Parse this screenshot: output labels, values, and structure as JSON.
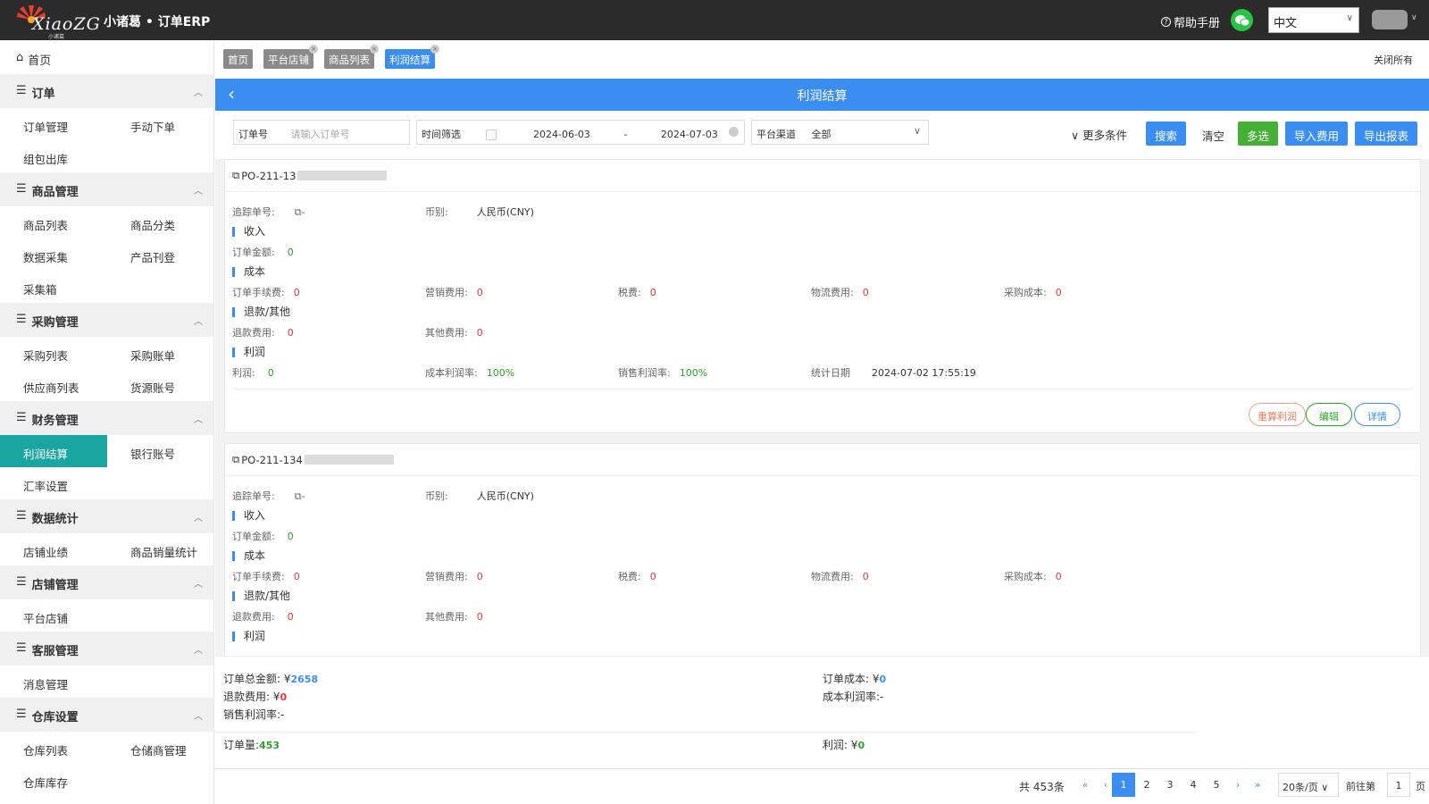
{
  "app": {
    "logo_text": "XiaoZG",
    "logo_sub": "小诸葛",
    "title": "小诸葛 • 订单ERP",
    "help": "帮助手册",
    "language": "中文"
  },
  "sidebar": {
    "home": "首页",
    "groups": [
      {
        "label": "订单",
        "items": [
          "订单管理",
          "手动下单",
          "组包出库"
        ]
      },
      {
        "label": "商品管理",
        "items": [
          "商品列表",
          "商品分类",
          "数据采集",
          "产品刊登",
          "采集箱"
        ]
      },
      {
        "label": "采购管理",
        "items": [
          "采购列表",
          "采购账单",
          "供应商列表",
          "货源账号"
        ]
      },
      {
        "label": "财务管理",
        "items": [
          "利润结算",
          "银行账号",
          "汇率设置"
        ],
        "active": "利润结算"
      },
      {
        "label": "数据统计",
        "items": [
          "店铺业绩",
          "商品销量统计"
        ]
      },
      {
        "label": "店铺管理",
        "items": [
          "平台店铺"
        ]
      },
      {
        "label": "客服管理",
        "items": [
          "消息管理"
        ]
      },
      {
        "label": "仓库设置",
        "items": [
          "仓库列表",
          "仓储商管理",
          "仓库库存"
        ]
      }
    ]
  },
  "tabs": [
    "首页",
    "平台店铺",
    "商品列表",
    "利润结算"
  ],
  "close_all": "关闭所有",
  "page_title": "利润结算",
  "filters": {
    "order_label": "订单号",
    "order_placeholder": "请输入订单号",
    "time_label": "时间筛选",
    "date_start": "2024-06-03",
    "date_sep": "-",
    "date_end": "2024-07-03",
    "channel_label": "平台渠道",
    "channel_value": "全部",
    "more": "更多条件",
    "search": "搜索",
    "clear": "清空",
    "multi": "多选",
    "import": "导入费用",
    "export": "导出报表"
  },
  "labels": {
    "tracking": "追踪单号:",
    "tracking_value": "-",
    "currency": "币别:",
    "currency_value": "人民币(CNY)",
    "income": "收入",
    "order_amount": "订单金额:",
    "cost": "成本",
    "fee": "订单手续费:",
    "marketing": "营销费用:",
    "tax": "税费:",
    "logistics": "物流费用:",
    "purchase": "采购成本:",
    "refund_sec": "退款/其他",
    "refund": "退款费用:",
    "other": "其他费用:",
    "profit_sec": "利润",
    "profit": "利润:",
    "cost_rate": "成本利润率:",
    "sale_rate": "销售利润率:",
    "stat_date": "统计日期",
    "btn_recalc": "重算利润",
    "btn_edit": "编辑",
    "btn_detail": "详情"
  },
  "cards": [
    {
      "order_no": "PO-211-13",
      "order_amount": "0",
      "fee": "0",
      "marketing": "0",
      "tax": "0",
      "logistics": "0",
      "purchase": "0",
      "refund": "0",
      "other": "0",
      "profit": "0",
      "cost_rate": "100%",
      "sale_rate": "100%",
      "stat_date": "2024-07-02 17:55:19"
    },
    {
      "order_no": "PO-211-134",
      "order_amount": "0",
      "fee": "0",
      "marketing": "0",
      "tax": "0",
      "logistics": "0",
      "purchase": "0",
      "refund": "0",
      "other": "0"
    }
  ],
  "summary": {
    "total_amount_label": "订单总金额: ¥",
    "total_amount": "2658",
    "order_cost_label": "订单成本: ¥",
    "order_cost": "0",
    "refund_label": "退款费用: ¥",
    "refund": "0",
    "cost_rate_label": "成本利润率:",
    "cost_rate": "-",
    "sale_rate_label": "销售利润率:",
    "sale_rate": "-",
    "count_label": "订单量:",
    "count": "453",
    "profit_label": "利润: ¥",
    "profit": "0"
  },
  "pager": {
    "total": "共 453条",
    "pages": [
      "1",
      "2",
      "3",
      "4",
      "5"
    ],
    "current": "1",
    "size": "20条/页",
    "goto": "前往第",
    "goto_value": "1",
    "page_suffix": "页"
  },
  "colors": {
    "topbar": "#2b2b2b",
    "primary": "#3a8ef2",
    "active": "#1aa6a0",
    "green": "#2aa52a",
    "red": "#e33"
  }
}
